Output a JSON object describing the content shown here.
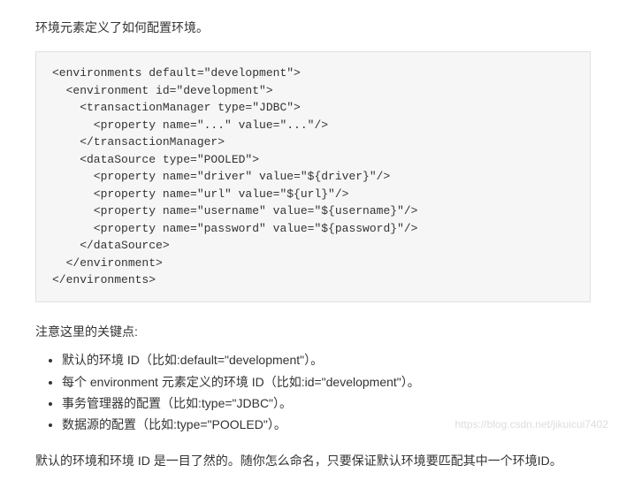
{
  "intro": "环境元素定义了如何配置环境。",
  "code": "<environments default=\"development\">\n  <environment id=\"development\">\n    <transactionManager type=\"JDBC\">\n      <property name=\"...\" value=\"...\"/>\n    </transactionManager>\n    <dataSource type=\"POOLED\">\n      <property name=\"driver\" value=\"${driver}\"/>\n      <property name=\"url\" value=\"${url}\"/>\n      <property name=\"username\" value=\"${username}\"/>\n      <property name=\"password\" value=\"${password}\"/>\n    </dataSource>\n  </environment>\n</environments>",
  "note_title": "注意这里的关键点:",
  "bullets": [
    "默认的环境 ID（比如:default=\"development\"）。",
    "每个 environment 元素定义的环境 ID（比如:id=\"development\"）。",
    "事务管理器的配置（比如:type=\"JDBC\"）。",
    "数据源的配置（比如:type=\"POOLED\"）。"
  ],
  "closing": "默认的环境和环境 ID 是一目了然的。随你怎么命名，只要保证默认环境要匹配其中一个环境ID。",
  "watermark": "https://blog.csdn.net/jikuicui7402"
}
